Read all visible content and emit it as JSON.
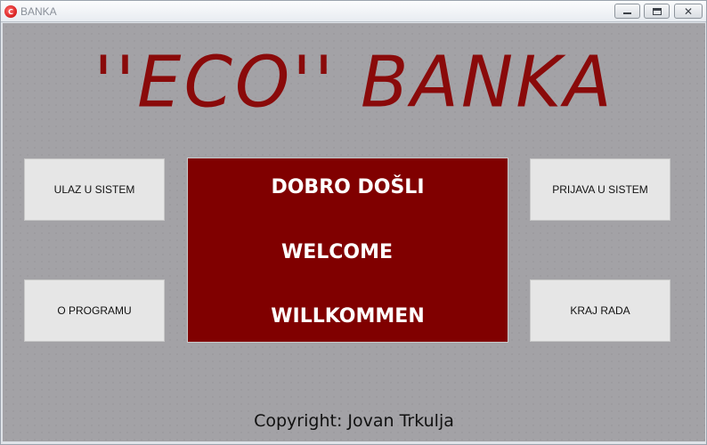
{
  "window": {
    "title": "BANKA",
    "icon": "app-logo-icon",
    "icon_glyph": "C",
    "controls": {
      "minimize": "minimize-icon",
      "maximize": "maximize-icon",
      "close": "close-icon",
      "close_glyph": "✕"
    }
  },
  "main": {
    "brand_title": "''ECO'' BANKA",
    "buttons": {
      "enter_system": "ULAZ U SISTEM",
      "about": "O PROGRAMU",
      "login": "PRIJAVA U SISTEM",
      "exit": "KRAJ RADA"
    },
    "welcome": {
      "line1": "DOBRO DOŠLI",
      "line2": "WELCOME",
      "line3": "WILLKOMMEN"
    },
    "copyright": "Copyright: Jovan Trkulja"
  },
  "colors": {
    "brand": "#8a0a0a",
    "panel": "#800000",
    "background": "#a3a2a6",
    "button_bg": "#e6e6e6"
  }
}
